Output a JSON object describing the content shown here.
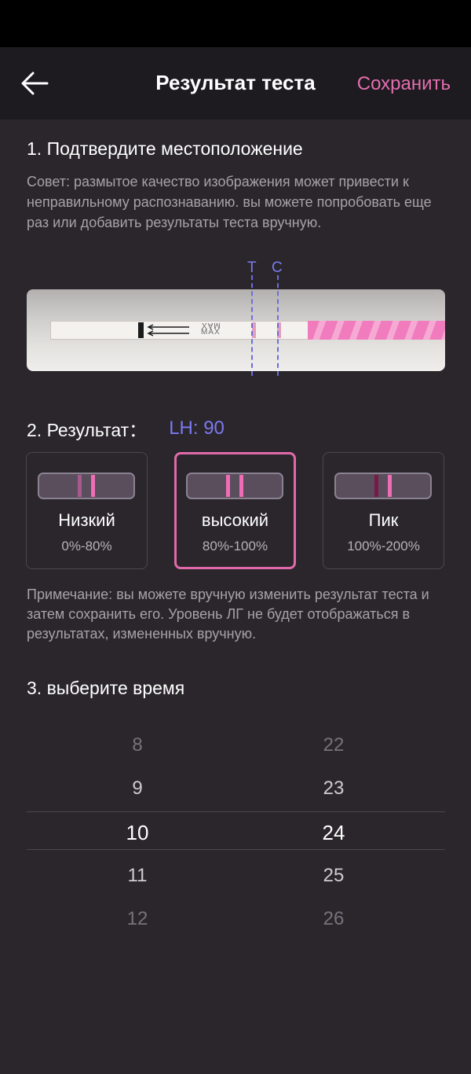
{
  "header": {
    "back_icon": "arrow-left-icon",
    "title": "Результат теста",
    "save_label": "Сохранить",
    "accent_color": "#e36fae"
  },
  "section1": {
    "title": "1. Подтвердите местоположение",
    "tip": "Совет: размытое качество изображения может привести к неправильному распознаванию. вы можете попробовать еще раз или добавить результаты теста вручную.",
    "strip_text": "MAX",
    "t_label": "T",
    "c_label": "C",
    "marker_color": "#7c79f0"
  },
  "section2": {
    "title": "2. Результат：",
    "lh_value": "LH: 90",
    "options": [
      {
        "title": "Низкий",
        "range": "0%-80%",
        "selected": false
      },
      {
        "title": "высокий",
        "range": "80%-100%",
        "selected": true
      },
      {
        "title": "Пик",
        "range": "100%-200%",
        "selected": false
      }
    ],
    "selected_color": "#e06aa9",
    "note": "Примечание: вы можете вручную изменить результат теста и затем сохранить его. Уровень ЛГ не будет отображаться в результатах, измененных вручную."
  },
  "section3": {
    "title": "3. выберите время",
    "hours": [
      "8",
      "9",
      "10",
      "11",
      "12"
    ],
    "minutes": [
      "22",
      "23",
      "24",
      "25",
      "26"
    ],
    "selected_hour": "10",
    "selected_minute": "24"
  }
}
